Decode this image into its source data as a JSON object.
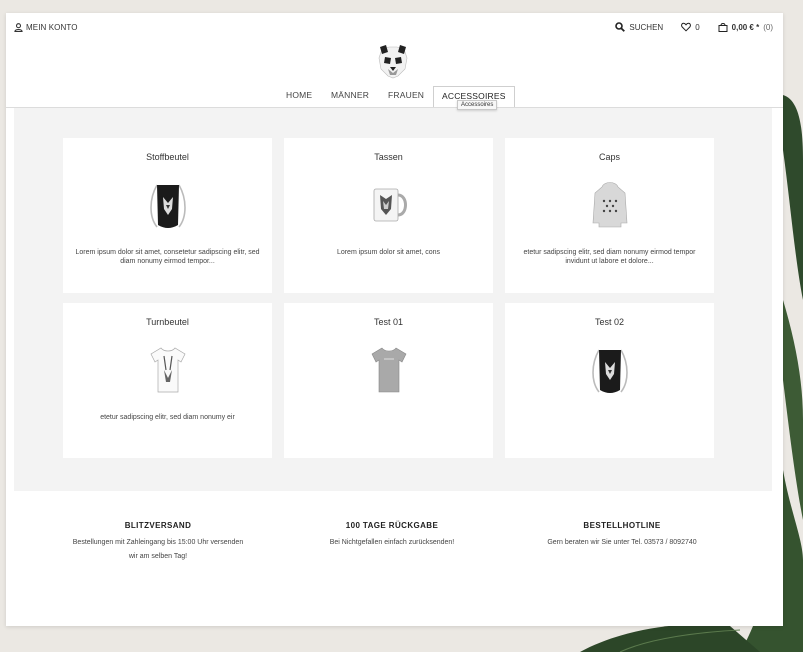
{
  "header": {
    "account_label": "MEIN KONTO",
    "search_label": "SUCHEN",
    "wishlist_count": "0",
    "cart_amount": "0,00 € *",
    "cart_count": "(0)"
  },
  "nav": {
    "items": [
      {
        "label": "HOME"
      },
      {
        "label": "MÄNNER"
      },
      {
        "label": "FRAUEN"
      },
      {
        "label": "ACCESSOIRES"
      }
    ],
    "tooltip": "Accessoires"
  },
  "products": [
    {
      "title": "Stoffbeutel",
      "text": "Lorem ipsum dolor sit amet, consetetur sadipscing elitr, sed diam nonumy eirmod tempor...",
      "image": "gymbag-black"
    },
    {
      "title": "Tassen",
      "text": "Lorem ipsum dolor sit amet, cons",
      "image": "mug-white"
    },
    {
      "title": "Caps",
      "text": "etetur sadipscing elitr, sed diam nonumy eirmod tempor invidunt ut labore et dolore...",
      "image": "hoodie-grey"
    },
    {
      "title": "Turnbeutel",
      "text": "etetur sadipscing elitr, sed diam nonumy eir",
      "image": "tshirt-white"
    },
    {
      "title": "Test 01",
      "text": "",
      "image": "tshirt-grey"
    },
    {
      "title": "Test 02",
      "text": "",
      "image": "gymbag-black"
    }
  ],
  "footer": [
    {
      "heading": "BLITZVERSAND",
      "line1": "Bestellungen mit Zahleingang bis 15:00 Uhr versenden",
      "line2": "wir am selben Tag!"
    },
    {
      "heading": "100 TAGE RÜCKGABE",
      "line1": "Bei Nichtgefallen einfach zurücksenden!",
      "line2": ""
    },
    {
      "heading": "BESTELLHOTLINE",
      "line1": "Gern beraten wir Sie unter Tel. 03573 / 8092740",
      "line2": ""
    }
  ]
}
